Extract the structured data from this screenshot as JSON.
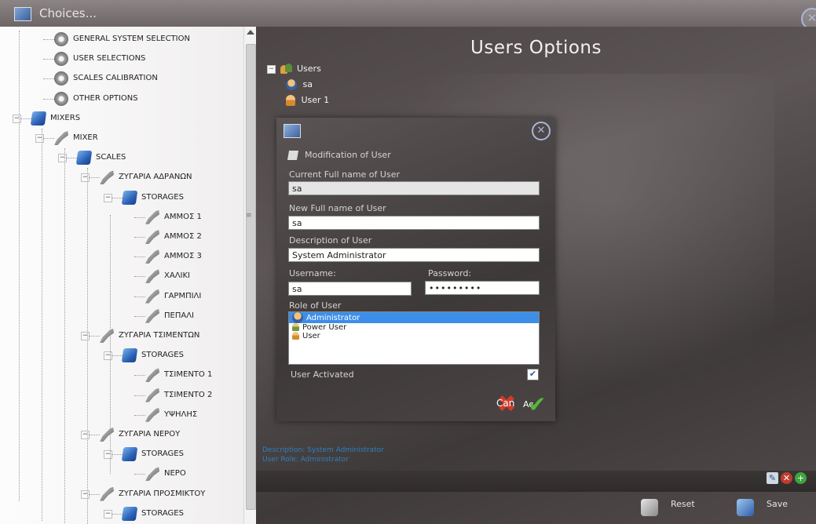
{
  "window": {
    "title": "Choices..."
  },
  "main": {
    "title": "Users Options",
    "users_tree": {
      "root": "Users",
      "items": [
        "sa",
        "User 1"
      ]
    },
    "info": {
      "line1": "Description: System Administrator",
      "line2": "User Role: Administrator"
    },
    "actions": {
      "reset": "Reset",
      "save": "Save"
    }
  },
  "tree": {
    "nodes": [
      "GENERAL SYSTEM SELECTION",
      "USER SELECTIONS",
      "SCALES CALIBRATION",
      "OTHER OPTIONS",
      "MIXERS",
      "MIXER",
      "SCALES",
      "ΖΥΓΑΡΙΑ ΑΔΡΑΝΩΝ",
      "STORAGES",
      "ΑΜΜΟΣ 1",
      "ΑΜΜΟΣ 2",
      "ΑΜΜΟΣ 3",
      "ΧΑΛΙΚΙ",
      "ΓΑΡΜΠΙΛΙ",
      "ΠΕΠΑΛΙ",
      "ΖΥΓΑΡΙΑ ΤΣΙΜΕΝΤΩΝ",
      "STORAGES",
      "ΤΣΙΜΕΝΤΟ 1",
      "ΤΣΙΜΕΝΤΟ 2",
      "ΥΨΗΛΗΣ",
      "ΖΥΓΑΡΙΑ ΝΕΡΟΥ",
      "STORAGES",
      "ΝΕΡΟ",
      "ΖΥΓΑΡΙΑ ΠΡΟΣΜΙΚΤΟΥ",
      "STORAGES"
    ]
  },
  "modal": {
    "header": "Modification of User",
    "current_name_label": "Current Full name of User",
    "current_name_value": "sa",
    "new_name_label": "New Full name of User",
    "new_name_value": "sa",
    "description_label": "Description of User",
    "description_value": "System Administrator",
    "username_label": "Username:",
    "username_value": "sa",
    "password_label": "Password:",
    "password_value": "•••••••••",
    "role_label": "Role of User",
    "roles": [
      "Administrator",
      "Power User",
      "User"
    ],
    "selected_role": "Administrator",
    "activated_label": "User Activated",
    "activated": true,
    "cancel_label": "Can",
    "accept_label": "Ac"
  },
  "icons": {
    "app": "app-icon",
    "close": "close-icon",
    "edit": "edit-icon",
    "delete": "delete-icon",
    "add": "add-icon",
    "reset": "reset-icon",
    "save": "save-icon"
  }
}
